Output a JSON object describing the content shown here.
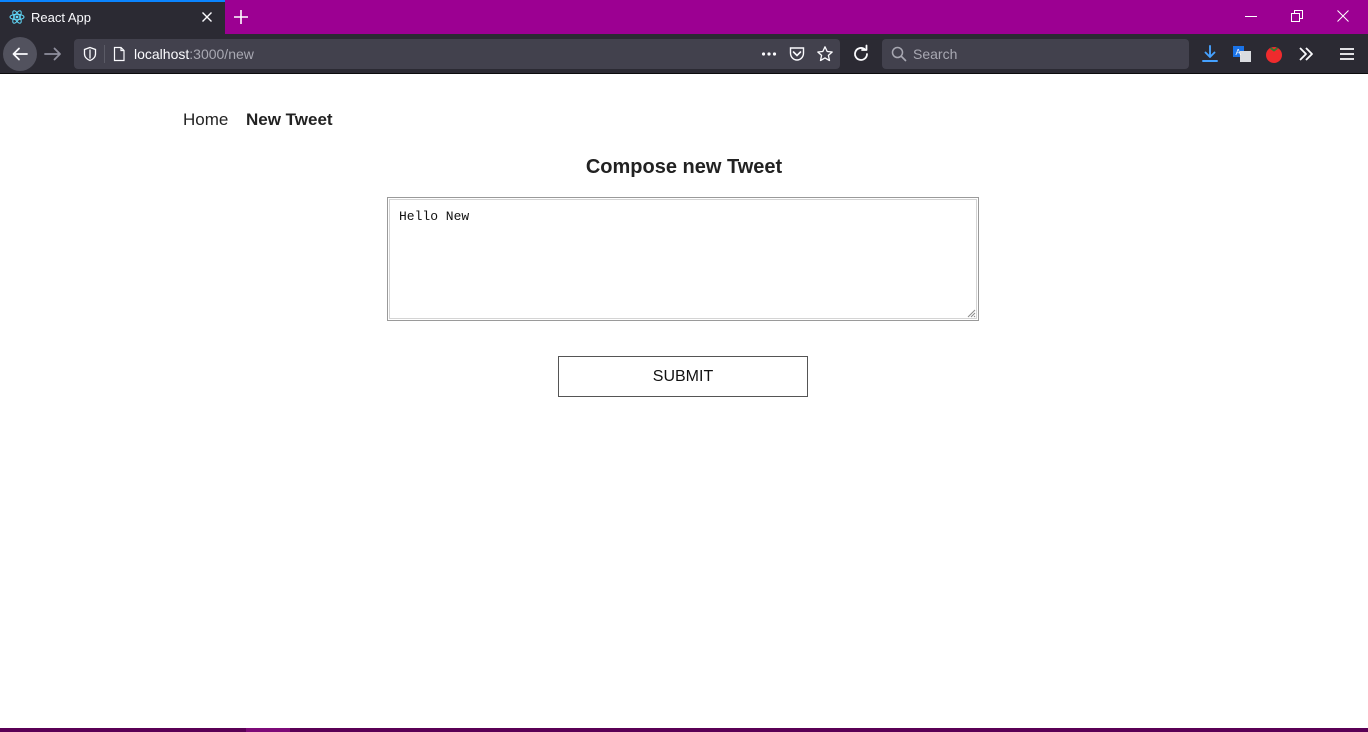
{
  "browser": {
    "tab": {
      "title": "React App"
    },
    "url": {
      "host": "localhost",
      "rest": ":3000/new"
    },
    "search": {
      "placeholder": "Search"
    },
    "colors": {
      "tabstrip": "#9c0092",
      "toolbar": "#2b2a33",
      "urlbar": "#42414d",
      "accent": "#0a84ff"
    }
  },
  "nav": {
    "home": "Home",
    "new_tweet": "New Tweet"
  },
  "compose": {
    "heading": "Compose new Tweet",
    "text": "Hello New",
    "submit_label": "SUBMIT"
  }
}
